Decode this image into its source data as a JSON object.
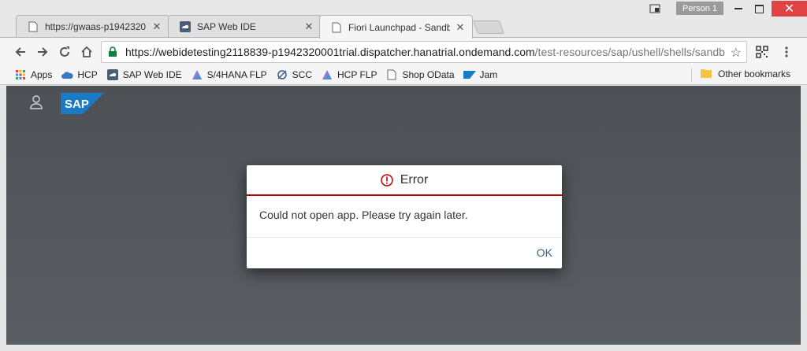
{
  "browser": {
    "tabs": [
      {
        "title": "https://gwaas-p1942320",
        "favicon": "page-icon"
      },
      {
        "title": "SAP Web IDE",
        "favicon": "sap-webide-icon"
      },
      {
        "title": "Fiori Launchpad - Sandb",
        "favicon": "page-icon",
        "active": true
      }
    ],
    "profile_label": "Person 1",
    "url_host": "https://webidetesting2118839-p1942320001trial.dispatcher.hanatrial.ondemand.com",
    "url_path": "/test-resources/sap/ushell/shells/sandb",
    "bookmarks": [
      {
        "label": "Apps",
        "icon": "apps-grid-icon"
      },
      {
        "label": "HCP",
        "icon": "cloud-icon"
      },
      {
        "label": "SAP Web IDE",
        "icon": "sap-webide-icon"
      },
      {
        "label": "S/4HANA FLP",
        "icon": "flp-icon"
      },
      {
        "label": "SCC",
        "icon": "scc-icon"
      },
      {
        "label": "HCP FLP",
        "icon": "flp-icon"
      },
      {
        "label": "Shop OData",
        "icon": "page-icon"
      },
      {
        "label": "Jam",
        "icon": "sap-icon"
      }
    ],
    "other_bookmarks_label": "Other bookmarks"
  },
  "dialog": {
    "title": "Error",
    "message": "Could not open app. Please try again later.",
    "ok_label": "OK"
  },
  "colors": {
    "error_red": "#bb0000",
    "ok_link": "#346187",
    "shell_bg": "#4c5055",
    "url_secure_green": "#0b8043"
  }
}
